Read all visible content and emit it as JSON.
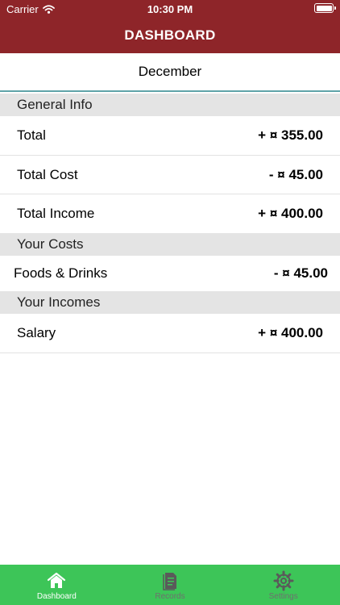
{
  "status_bar": {
    "carrier": "Carrier",
    "time": "10:30 PM"
  },
  "header": {
    "title": "DASHBOARD"
  },
  "month": "December",
  "sections": {
    "general": {
      "title": "General Info",
      "rows": [
        {
          "label": "Total",
          "amount": "+ ¤ 355.00"
        },
        {
          "label": "Total Cost",
          "amount": "- ¤ 45.00"
        },
        {
          "label": "Total Income",
          "amount": "+ ¤ 400.00"
        }
      ]
    },
    "costs": {
      "title": "Your Costs",
      "rows": [
        {
          "label": "Foods & Drinks",
          "amount": "- ¤ 45.00"
        }
      ]
    },
    "incomes": {
      "title": "Your Incomes",
      "rows": [
        {
          "label": "Salary",
          "amount": "+ ¤ 400.00"
        }
      ]
    }
  },
  "tabs": [
    {
      "label": "Dashboard",
      "icon": "home-icon",
      "active": true
    },
    {
      "label": "Records",
      "icon": "records-icon",
      "active": false
    },
    {
      "label": "Settings",
      "icon": "gear-icon",
      "active": false
    }
  ],
  "colors": {
    "header": "#8e2529",
    "tab_bar": "#3dc558",
    "section_header": "#e4e4e4",
    "month_divider": "#5fa3a8",
    "tab_active": "#ffffff",
    "tab_inactive": "#6f6f6f"
  }
}
